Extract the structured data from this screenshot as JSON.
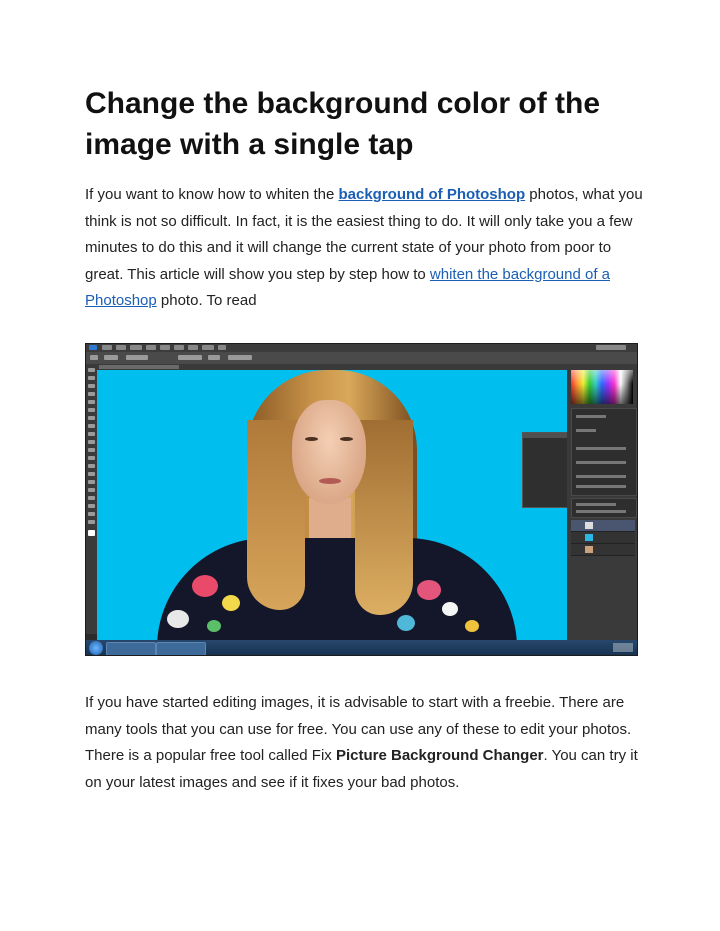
{
  "title": "Change the background color of the image with a single tap",
  "paragraph1": {
    "text_before_link1": "If you want to know how to whiten the ",
    "link1": "background of Photoshop",
    "text_after_link1": " photos, what you think is not so difficult. In fact, it is the easiest thing to do. It will only take you a few minutes to do this and it will change the current state of your photo from poor to great. This article will show you step by step how to ",
    "link2": "whiten the background of a Photoshop",
    "text_after_link2": " photo. To read"
  },
  "paragraph2": {
    "text_before_bold": "If you have started editing images, it is advisable to start with a freebie. There are many tools that you can use for free. You can use any of these to edit your photos. There is a popular free tool called Fix ",
    "bold": "Picture Background Changer",
    "text_after_bold": ". You can try it on your latest images and see if it fixes your bad photos."
  },
  "colors": {
    "link": "#1a5fb4",
    "canvas_background": "#00bfef"
  }
}
